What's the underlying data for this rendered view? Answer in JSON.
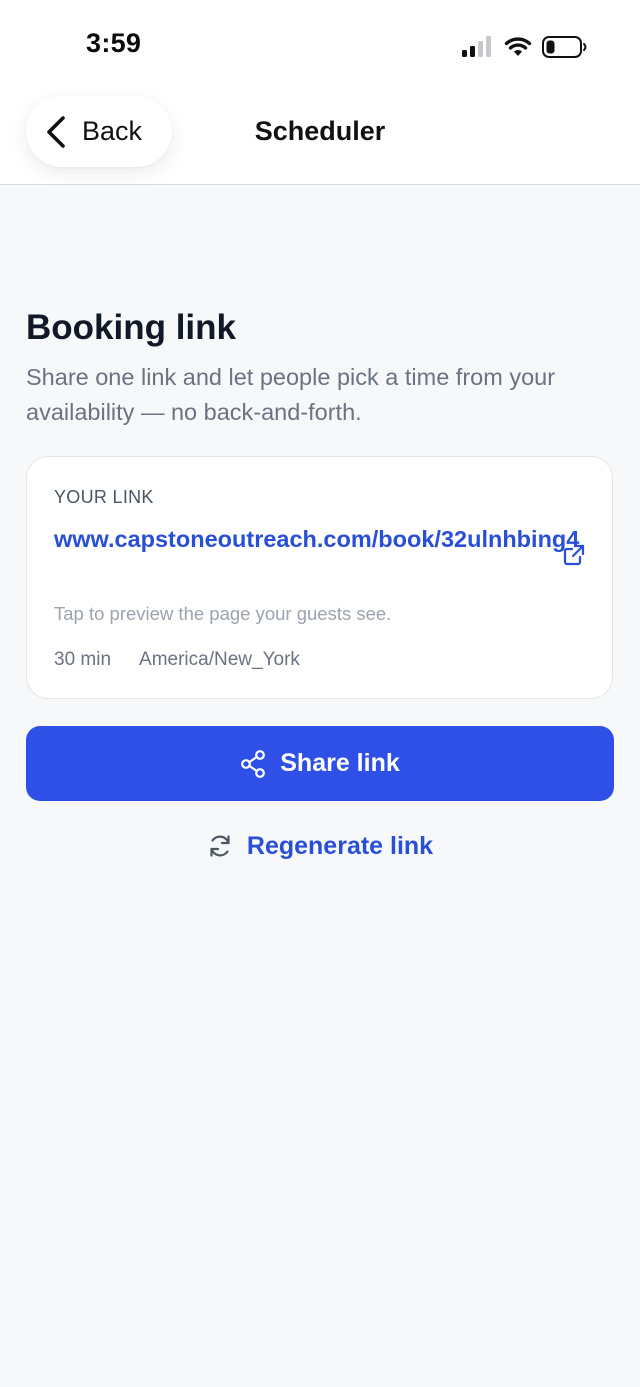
{
  "status_bar": {
    "time": "3:59"
  },
  "nav": {
    "back_label": "Back",
    "title": "Scheduler"
  },
  "main": {
    "heading": "Booking link",
    "subtitle": "Share one link and let people pick a time from your availability — no back-and-forth."
  },
  "link_card": {
    "label": "YOUR LINK",
    "url": "www.capstoneoutreach.com/book/32ulnhbing4",
    "hint": "Tap to preview the page your guests see.",
    "duration": "30 min",
    "timezone": "America/New_York"
  },
  "actions": {
    "share_label": "Share link",
    "regenerate_label": "Regenerate link"
  },
  "icons": {
    "back": "chevron-left-icon",
    "external": "external-link-icon",
    "share": "share-icon",
    "regenerate": "refresh-icon",
    "signal": "cellular-signal-icon",
    "wifi": "wifi-icon",
    "battery": "battery-icon"
  },
  "colors": {
    "accent": "#2e50e6",
    "link": "#2a4fd7",
    "background": "#f7f8fa"
  }
}
